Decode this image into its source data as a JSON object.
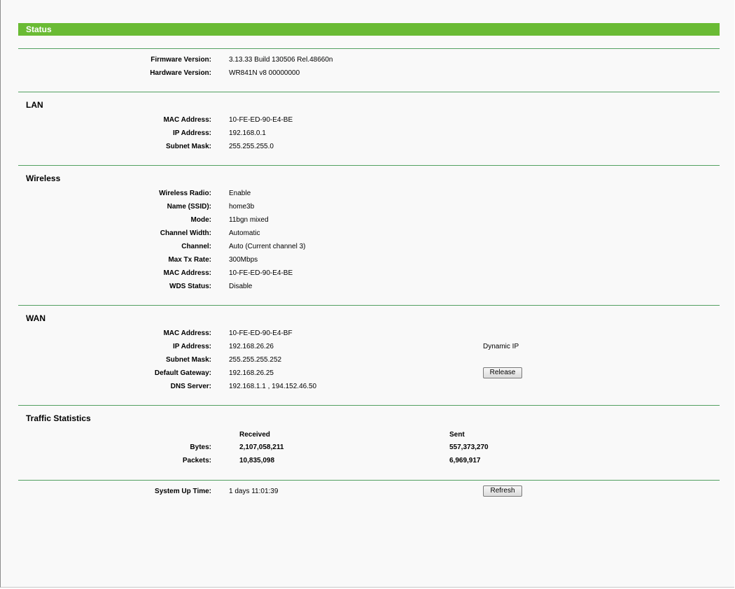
{
  "header": {
    "title": "Status"
  },
  "firmware": {
    "firmware_version_label": "Firmware Version:",
    "firmware_version": "3.13.33 Build 130506 Rel.48660n",
    "hardware_version_label": "Hardware Version:",
    "hardware_version": "WR841N v8 00000000"
  },
  "lan": {
    "title": "LAN",
    "mac_label": "MAC Address:",
    "mac": "10-FE-ED-90-E4-BE",
    "ip_label": "IP Address:",
    "ip": "192.168.0.1",
    "mask_label": "Subnet Mask:",
    "mask": "255.255.255.0"
  },
  "wireless": {
    "title": "Wireless",
    "radio_label": "Wireless Radio:",
    "radio": "Enable",
    "ssid_label": "Name (SSID):",
    "ssid": "home3b",
    "mode_label": "Mode:",
    "mode": "11bgn mixed",
    "width_label": "Channel Width:",
    "width": "Automatic",
    "channel_label": "Channel:",
    "channel": "Auto (Current channel 3)",
    "rate_label": "Max Tx Rate:",
    "rate": "300Mbps",
    "mac_label": "MAC Address:",
    "mac": "10-FE-ED-90-E4-BE",
    "wds_label": "WDS Status:",
    "wds": "Disable"
  },
  "wan": {
    "title": "WAN",
    "mac_label": "MAC Address:",
    "mac": "10-FE-ED-90-E4-BF",
    "ip_label": "IP Address:",
    "ip": "192.168.26.26",
    "ip_type": "Dynamic IP",
    "mask_label": "Subnet Mask:",
    "mask": "255.255.255.252",
    "gateway_label": "Default Gateway:",
    "gateway": "192.168.26.25",
    "release_label": "Release",
    "dns_label": "DNS Server:",
    "dns": "192.168.1.1 , 194.152.46.50"
  },
  "traffic": {
    "title": "Traffic Statistics",
    "received_header": "Received",
    "sent_header": "Sent",
    "bytes_label": "Bytes:",
    "bytes_received": "2,107,058,211",
    "bytes_sent": "557,373,270",
    "packets_label": "Packets:",
    "packets_received": "10,835,098",
    "packets_sent": "6,969,917"
  },
  "uptime": {
    "label": "System Up Time:",
    "value": "1 days 11:01:39",
    "refresh_label": "Refresh"
  },
  "colors": {
    "header_green": "#6abb34",
    "divider_green": "#52a060",
    "background": "#f9f9f9"
  }
}
